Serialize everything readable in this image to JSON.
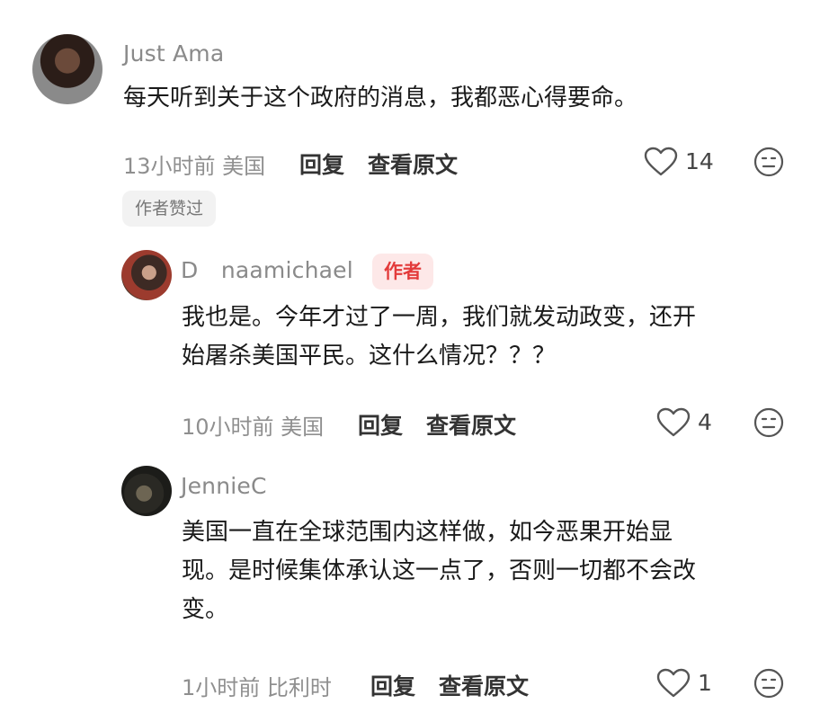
{
  "comments": [
    {
      "username": "Just Ama",
      "text_lines": [
        "每天听到关于这个政府的消息，我都恶心得要命。"
      ],
      "meta": "13小时前 美国",
      "reply_label": "回复",
      "translate_label": "查看原文",
      "likes": "14",
      "liked_badge": "作者赞过"
    },
    {
      "username": "D  naamichael",
      "author_badge": "作者",
      "text_lines": [
        "我也是。今年才过了一周，我们就发动政变，还开",
        "始屠杀美国平民。这什么情况？？？"
      ],
      "meta": "10小时前 美国",
      "reply_label": "回复",
      "translate_label": "查看原文",
      "likes": "4"
    },
    {
      "username": "JennieC",
      "text_lines": [
        "美国一直在全球范围内这样做，如今恶果开始显",
        "现。是时候集体承认这一点了，否则一切都不会改",
        "变。"
      ],
      "meta": "1小时前 比利时",
      "reply_label": "回复",
      "translate_label": "查看原文",
      "likes": "1"
    }
  ],
  "icons": {
    "like": "heart-outline-icon",
    "reaction": "emoji-face-icon"
  },
  "colors": {
    "author_badge_text": "#e33b3b",
    "author_badge_bg": "#fde8e8",
    "meta_text": "#8f8f8f"
  }
}
